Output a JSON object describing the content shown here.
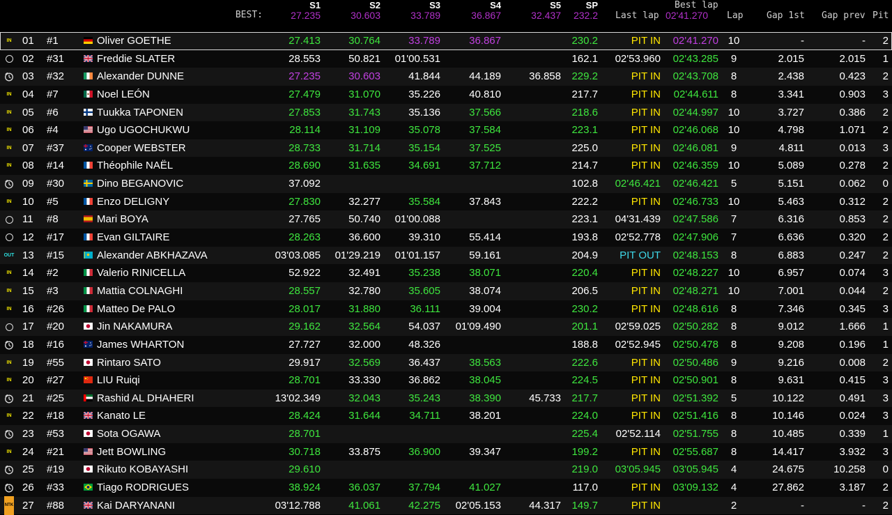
{
  "header": {
    "best_label": "BEST:",
    "col_s1": "S1",
    "best_s1": "27.235",
    "col_s2": "S2",
    "best_s2": "30.603",
    "col_s3": "S3",
    "best_s3": "33.789",
    "col_s4": "S4",
    "best_s4": "36.867",
    "col_s5": "S5",
    "best_s5": "32.437",
    "col_sp": "SP",
    "best_sp": "232.2",
    "col_last": "Last lap",
    "col_best": "Best lap",
    "best_lap": "02'41.270",
    "col_lap": "Lap",
    "col_gap1": "Gap 1st",
    "col_gapp": "Gap prev",
    "col_pit": "Pit"
  },
  "colors": {
    "green": "#3ee63e",
    "purple": "#c040e0",
    "yellow": "#ffe600",
    "cyan": "#3ed8e8",
    "white": "#ffffff"
  },
  "rows": [
    {
      "status": "IN",
      "pos": "01",
      "num": "#1",
      "flag": "de",
      "name": "Oliver GOETHE",
      "s1": [
        "27.413",
        "g"
      ],
      "s2": [
        "30.764",
        "g"
      ],
      "s3": [
        "33.789",
        "p"
      ],
      "s4": [
        "36.867",
        "p"
      ],
      "s5": [
        "",
        ""
      ],
      "sp": [
        "230.2",
        "g"
      ],
      "last": [
        "PIT IN",
        "y"
      ],
      "best": [
        "02'41.270",
        "p"
      ],
      "lap": "10",
      "gap1": "-",
      "gapp": "-",
      "pit": "2"
    },
    {
      "status": "circle",
      "pos": "02",
      "num": "#31",
      "flag": "gb",
      "name": "Freddie SLATER",
      "s1": [
        "28.553",
        "w"
      ],
      "s2": [
        "50.821",
        "w"
      ],
      "s3": [
        "01'00.531",
        "w"
      ],
      "s4": [
        "",
        ""
      ],
      "s5": [
        "",
        ""
      ],
      "sp": [
        "162.1",
        "w"
      ],
      "last": [
        "02'53.960",
        "w"
      ],
      "best": [
        "02'43.285",
        "g"
      ],
      "lap": "9",
      "gap1": "2.015",
      "gapp": "2.015",
      "pit": "1"
    },
    {
      "status": "timer",
      "pos": "03",
      "num": "#32",
      "flag": "ie",
      "name": "Alexander DUNNE",
      "s1": [
        "27.235",
        "p"
      ],
      "s2": [
        "30.603",
        "p"
      ],
      "s3": [
        "41.844",
        "w"
      ],
      "s4": [
        "44.189",
        "w"
      ],
      "s5": [
        "36.858",
        "w"
      ],
      "sp": [
        "229.2",
        "g"
      ],
      "last": [
        "PIT IN",
        "y"
      ],
      "best": [
        "02'43.708",
        "g"
      ],
      "lap": "8",
      "gap1": "2.438",
      "gapp": "0.423",
      "pit": "2"
    },
    {
      "status": "IN",
      "pos": "04",
      "num": "#7",
      "flag": "mx",
      "name": "Noel LEÓN",
      "s1": [
        "27.479",
        "g"
      ],
      "s2": [
        "31.070",
        "g"
      ],
      "s3": [
        "35.226",
        "w"
      ],
      "s4": [
        "40.810",
        "w"
      ],
      "s5": [
        "",
        ""
      ],
      "sp": [
        "217.7",
        "w"
      ],
      "last": [
        "PIT IN",
        "y"
      ],
      "best": [
        "02'44.611",
        "g"
      ],
      "lap": "8",
      "gap1": "3.341",
      "gapp": "0.903",
      "pit": "3"
    },
    {
      "status": "IN",
      "pos": "05",
      "num": "#6",
      "flag": "fi",
      "name": "Tuukka TAPONEN",
      "s1": [
        "27.853",
        "g"
      ],
      "s2": [
        "31.743",
        "g"
      ],
      "s3": [
        "35.136",
        "w"
      ],
      "s4": [
        "37.566",
        "g"
      ],
      "s5": [
        "",
        ""
      ],
      "sp": [
        "218.6",
        "g"
      ],
      "last": [
        "PIT IN",
        "y"
      ],
      "best": [
        "02'44.997",
        "g"
      ],
      "lap": "10",
      "gap1": "3.727",
      "gapp": "0.386",
      "pit": "2"
    },
    {
      "status": "IN",
      "pos": "06",
      "num": "#4",
      "flag": "us",
      "name": "Ugo UGOCHUKWU",
      "s1": [
        "28.114",
        "g"
      ],
      "s2": [
        "31.109",
        "g"
      ],
      "s3": [
        "35.078",
        "g"
      ],
      "s4": [
        "37.584",
        "g"
      ],
      "s5": [
        "",
        ""
      ],
      "sp": [
        "223.1",
        "g"
      ],
      "last": [
        "PIT IN",
        "y"
      ],
      "best": [
        "02'46.068",
        "g"
      ],
      "lap": "10",
      "gap1": "4.798",
      "gapp": "1.071",
      "pit": "2"
    },
    {
      "status": "IN",
      "pos": "07",
      "num": "#37",
      "flag": "au",
      "name": "Cooper WEBSTER",
      "s1": [
        "28.733",
        "g"
      ],
      "s2": [
        "31.714",
        "g"
      ],
      "s3": [
        "35.154",
        "g"
      ],
      "s4": [
        "37.525",
        "g"
      ],
      "s5": [
        "",
        ""
      ],
      "sp": [
        "225.0",
        "w"
      ],
      "last": [
        "PIT IN",
        "y"
      ],
      "best": [
        "02'46.081",
        "g"
      ],
      "lap": "9",
      "gap1": "4.811",
      "gapp": "0.013",
      "pit": "3"
    },
    {
      "status": "IN",
      "pos": "08",
      "num": "#14",
      "flag": "fr",
      "name": "Théophile NAËL",
      "s1": [
        "28.690",
        "g"
      ],
      "s2": [
        "31.635",
        "g"
      ],
      "s3": [
        "34.691",
        "g"
      ],
      "s4": [
        "37.712",
        "g"
      ],
      "s5": [
        "",
        ""
      ],
      "sp": [
        "214.7",
        "w"
      ],
      "last": [
        "PIT IN",
        "y"
      ],
      "best": [
        "02'46.359",
        "g"
      ],
      "lap": "10",
      "gap1": "5.089",
      "gapp": "0.278",
      "pit": "2"
    },
    {
      "status": "timer",
      "pos": "09",
      "num": "#30",
      "flag": "se",
      "name": "Dino BEGANOVIC",
      "s1": [
        "37.092",
        "w"
      ],
      "s2": [
        "",
        ""
      ],
      "s3": [
        "",
        ""
      ],
      "s4": [
        "",
        ""
      ],
      "s5": [
        "",
        ""
      ],
      "sp": [
        "102.8",
        "w"
      ],
      "last": [
        "02'46.421",
        "g"
      ],
      "best": [
        "02'46.421",
        "g"
      ],
      "lap": "5",
      "gap1": "5.151",
      "gapp": "0.062",
      "pit": "0"
    },
    {
      "status": "IN",
      "pos": "10",
      "num": "#5",
      "flag": "fr",
      "name": "Enzo DELIGNY",
      "s1": [
        "27.830",
        "g"
      ],
      "s2": [
        "32.277",
        "w"
      ],
      "s3": [
        "35.584",
        "g"
      ],
      "s4": [
        "37.843",
        "w"
      ],
      "s5": [
        "",
        ""
      ],
      "sp": [
        "222.2",
        "w"
      ],
      "last": [
        "PIT IN",
        "y"
      ],
      "best": [
        "02'46.733",
        "g"
      ],
      "lap": "10",
      "gap1": "5.463",
      "gapp": "0.312",
      "pit": "2"
    },
    {
      "status": "circle",
      "pos": "11",
      "num": "#8",
      "flag": "es",
      "name": "Mari BOYA",
      "s1": [
        "27.765",
        "w"
      ],
      "s2": [
        "50.740",
        "w"
      ],
      "s3": [
        "01'00.088",
        "w"
      ],
      "s4": [
        "",
        ""
      ],
      "s5": [
        "",
        ""
      ],
      "sp": [
        "223.1",
        "w"
      ],
      "last": [
        "04'31.439",
        "w"
      ],
      "best": [
        "02'47.586",
        "g"
      ],
      "lap": "7",
      "gap1": "6.316",
      "gapp": "0.853",
      "pit": "2"
    },
    {
      "status": "circle",
      "pos": "12",
      "num": "#17",
      "flag": "fr",
      "name": "Evan GILTAIRE",
      "s1": [
        "28.263",
        "g"
      ],
      "s2": [
        "36.600",
        "w"
      ],
      "s3": [
        "39.310",
        "w"
      ],
      "s4": [
        "55.414",
        "w"
      ],
      "s5": [
        "",
        ""
      ],
      "sp": [
        "193.8",
        "w"
      ],
      "last": [
        "02'52.778",
        "w"
      ],
      "best": [
        "02'47.906",
        "g"
      ],
      "lap": "7",
      "gap1": "6.636",
      "gapp": "0.320",
      "pit": "2"
    },
    {
      "status": "OUT",
      "pos": "13",
      "num": "#15",
      "flag": "kz",
      "name": "Alexander ABKHAZAVA",
      "s1": [
        "03'03.085",
        "w"
      ],
      "s2": [
        "01'29.219",
        "w"
      ],
      "s3": [
        "01'01.157",
        "w"
      ],
      "s4": [
        "59.161",
        "w"
      ],
      "s5": [
        "",
        ""
      ],
      "sp": [
        "204.9",
        "w"
      ],
      "last": [
        "PIT OUT",
        "cy"
      ],
      "best": [
        "02'48.153",
        "g"
      ],
      "lap": "8",
      "gap1": "6.883",
      "gapp": "0.247",
      "pit": "2"
    },
    {
      "status": "IN",
      "pos": "14",
      "num": "#2",
      "flag": "it",
      "name": "Valerio RINICELLA",
      "s1": [
        "52.922",
        "w"
      ],
      "s2": [
        "32.491",
        "w"
      ],
      "s3": [
        "35.238",
        "g"
      ],
      "s4": [
        "38.071",
        "g"
      ],
      "s5": [
        "",
        ""
      ],
      "sp": [
        "220.4",
        "g"
      ],
      "last": [
        "PIT IN",
        "y"
      ],
      "best": [
        "02'48.227",
        "g"
      ],
      "lap": "10",
      "gap1": "6.957",
      "gapp": "0.074",
      "pit": "3"
    },
    {
      "status": "IN",
      "pos": "15",
      "num": "#3",
      "flag": "it",
      "name": "Mattia COLNAGHI",
      "s1": [
        "28.557",
        "g"
      ],
      "s2": [
        "32.780",
        "w"
      ],
      "s3": [
        "35.605",
        "g"
      ],
      "s4": [
        "38.074",
        "w"
      ],
      "s5": [
        "",
        ""
      ],
      "sp": [
        "206.5",
        "w"
      ],
      "last": [
        "PIT IN",
        "y"
      ],
      "best": [
        "02'48.271",
        "g"
      ],
      "lap": "10",
      "gap1": "7.001",
      "gapp": "0.044",
      "pit": "2"
    },
    {
      "status": "IN",
      "pos": "16",
      "num": "#26",
      "flag": "it",
      "name": "Matteo De PALO",
      "s1": [
        "28.017",
        "g"
      ],
      "s2": [
        "31.880",
        "g"
      ],
      "s3": [
        "36.111",
        "g"
      ],
      "s4": [
        "39.004",
        "w"
      ],
      "s5": [
        "",
        ""
      ],
      "sp": [
        "230.2",
        "g"
      ],
      "last": [
        "PIT IN",
        "y"
      ],
      "best": [
        "02'48.616",
        "g"
      ],
      "lap": "8",
      "gap1": "7.346",
      "gapp": "0.345",
      "pit": "3"
    },
    {
      "status": "circle",
      "pos": "17",
      "num": "#20",
      "flag": "jp",
      "name": "Jin NAKAMURA",
      "s1": [
        "29.162",
        "g"
      ],
      "s2": [
        "32.564",
        "g"
      ],
      "s3": [
        "54.037",
        "w"
      ],
      "s4": [
        "01'09.490",
        "w"
      ],
      "s5": [
        "",
        ""
      ],
      "sp": [
        "201.1",
        "g"
      ],
      "last": [
        "02'59.025",
        "w"
      ],
      "best": [
        "02'50.282",
        "g"
      ],
      "lap": "8",
      "gap1": "9.012",
      "gapp": "1.666",
      "pit": "1"
    },
    {
      "status": "timer",
      "pos": "18",
      "num": "#16",
      "flag": "au",
      "name": "James WHARTON",
      "s1": [
        "27.727",
        "w"
      ],
      "s2": [
        "32.000",
        "w"
      ],
      "s3": [
        "48.326",
        "w"
      ],
      "s4": [
        "",
        ""
      ],
      "s5": [
        "",
        ""
      ],
      "sp": [
        "188.8",
        "w"
      ],
      "last": [
        "02'52.945",
        "w"
      ],
      "best": [
        "02'50.478",
        "g"
      ],
      "lap": "8",
      "gap1": "9.208",
      "gapp": "0.196",
      "pit": "1"
    },
    {
      "status": "IN",
      "pos": "19",
      "num": "#55",
      "flag": "jp",
      "name": "Rintaro SATO",
      "s1": [
        "29.917",
        "w"
      ],
      "s2": [
        "32.569",
        "g"
      ],
      "s3": [
        "36.437",
        "w"
      ],
      "s4": [
        "38.563",
        "g"
      ],
      "s5": [
        "",
        ""
      ],
      "sp": [
        "222.6",
        "g"
      ],
      "last": [
        "PIT IN",
        "y"
      ],
      "best": [
        "02'50.486",
        "g"
      ],
      "lap": "9",
      "gap1": "9.216",
      "gapp": "0.008",
      "pit": "2"
    },
    {
      "status": "IN",
      "pos": "20",
      "num": "#27",
      "flag": "cn",
      "name": "LIU Ruiqi",
      "s1": [
        "28.701",
        "g"
      ],
      "s2": [
        "33.330",
        "w"
      ],
      "s3": [
        "36.862",
        "w"
      ],
      "s4": [
        "38.045",
        "g"
      ],
      "s5": [
        "",
        ""
      ],
      "sp": [
        "224.5",
        "g"
      ],
      "last": [
        "PIT IN",
        "y"
      ],
      "best": [
        "02'50.901",
        "g"
      ],
      "lap": "8",
      "gap1": "9.631",
      "gapp": "0.415",
      "pit": "3"
    },
    {
      "status": "timer",
      "pos": "21",
      "num": "#25",
      "flag": "ae",
      "name": "Rashid AL DHAHERI",
      "s1": [
        "13'02.349",
        "w"
      ],
      "s2": [
        "32.043",
        "g"
      ],
      "s3": [
        "35.243",
        "g"
      ],
      "s4": [
        "38.390",
        "g"
      ],
      "s5": [
        "45.733",
        "w"
      ],
      "sp": [
        "217.7",
        "g"
      ],
      "last": [
        "PIT IN",
        "y"
      ],
      "best": [
        "02'51.392",
        "g"
      ],
      "lap": "5",
      "gap1": "10.122",
      "gapp": "0.491",
      "pit": "3"
    },
    {
      "status": "IN",
      "pos": "22",
      "num": "#18",
      "flag": "gb",
      "name": "Kanato LE",
      "s1": [
        "28.424",
        "g"
      ],
      "s2": [
        "31.644",
        "g"
      ],
      "s3": [
        "34.711",
        "g"
      ],
      "s4": [
        "38.201",
        "w"
      ],
      "s5": [
        "",
        ""
      ],
      "sp": [
        "224.0",
        "g"
      ],
      "last": [
        "PIT IN",
        "y"
      ],
      "best": [
        "02'51.416",
        "g"
      ],
      "lap": "8",
      "gap1": "10.146",
      "gapp": "0.024",
      "pit": "3"
    },
    {
      "status": "timer",
      "pos": "23",
      "num": "#53",
      "flag": "jp",
      "name": "Sota OGAWA",
      "s1": [
        "28.701",
        "g"
      ],
      "s2": [
        "",
        ""
      ],
      "s3": [
        "",
        ""
      ],
      "s4": [
        "",
        ""
      ],
      "s5": [
        "",
        ""
      ],
      "sp": [
        "225.4",
        "g"
      ],
      "last": [
        "02'52.114",
        "w"
      ],
      "best": [
        "02'51.755",
        "g"
      ],
      "lap": "8",
      "gap1": "10.485",
      "gapp": "0.339",
      "pit": "1"
    },
    {
      "status": "IN",
      "pos": "24",
      "num": "#21",
      "flag": "us",
      "name": "Jett BOWLING",
      "s1": [
        "30.718",
        "g"
      ],
      "s2": [
        "33.875",
        "w"
      ],
      "s3": [
        "36.900",
        "g"
      ],
      "s4": [
        "39.347",
        "w"
      ],
      "s5": [
        "",
        ""
      ],
      "sp": [
        "199.2",
        "g"
      ],
      "last": [
        "PIT IN",
        "y"
      ],
      "best": [
        "02'55.687",
        "g"
      ],
      "lap": "8",
      "gap1": "14.417",
      "gapp": "3.932",
      "pit": "3"
    },
    {
      "status": "timer",
      "pos": "25",
      "num": "#19",
      "flag": "jp",
      "name": "Rikuto KOBAYASHI",
      "s1": [
        "29.610",
        "g"
      ],
      "s2": [
        "",
        ""
      ],
      "s3": [
        "",
        ""
      ],
      "s4": [
        "",
        ""
      ],
      "s5": [
        "",
        ""
      ],
      "sp": [
        "219.0",
        "g"
      ],
      "last": [
        "03'05.945",
        "g"
      ],
      "best": [
        "03'05.945",
        "g"
      ],
      "lap": "4",
      "gap1": "24.675",
      "gapp": "10.258",
      "pit": "0"
    },
    {
      "status": "timer",
      "pos": "26",
      "num": "#33",
      "flag": "br",
      "name": "Tiago RODRIGUES",
      "s1": [
        "38.924",
        "g"
      ],
      "s2": [
        "36.037",
        "g"
      ],
      "s3": [
        "37.794",
        "g"
      ],
      "s4": [
        "41.027",
        "g"
      ],
      "s5": [
        "",
        ""
      ],
      "sp": [
        "117.0",
        "w"
      ],
      "last": [
        "PIT IN",
        "y"
      ],
      "best": [
        "03'09.132",
        "g"
      ],
      "lap": "4",
      "gap1": "27.862",
      "gapp": "3.187",
      "pit": "2"
    },
    {
      "status": "NTK",
      "pos": "27",
      "num": "#88",
      "flag": "gb",
      "name": "Kai DARYANANI",
      "s1": [
        "03'12.788",
        "w"
      ],
      "s2": [
        "41.061",
        "g"
      ],
      "s3": [
        "42.275",
        "g"
      ],
      "s4": [
        "02'05.153",
        "w"
      ],
      "s5": [
        "44.317",
        "w"
      ],
      "sp": [
        "149.7",
        "g"
      ],
      "last": [
        "PIT IN",
        "y"
      ],
      "best": [
        "",
        ""
      ],
      "lap": "2",
      "gap1": "-",
      "gapp": "-",
      "pit": "2"
    }
  ]
}
